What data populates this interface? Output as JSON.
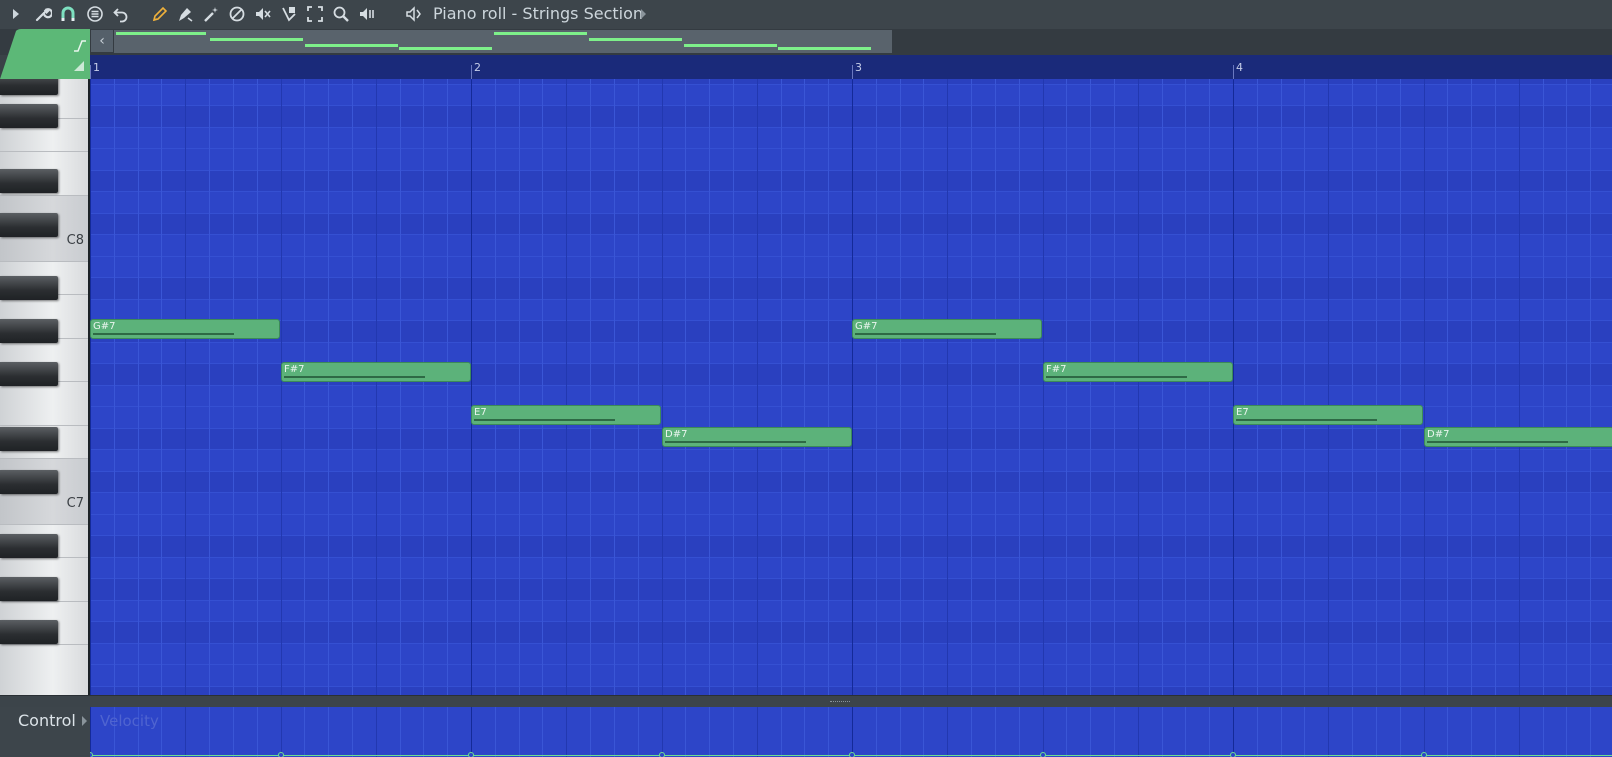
{
  "window": {
    "title": "Piano roll - Strings Section"
  },
  "toolbar": {
    "tools": [
      {
        "name": "wrench-icon",
        "active": false
      },
      {
        "name": "magnet-icon",
        "active": true
      },
      {
        "name": "menu-circle-icon",
        "active": false
      },
      {
        "name": "undo-icon",
        "active": false
      },
      {
        "name": "pencil-icon",
        "active": true
      },
      {
        "name": "paint-brush-icon",
        "active": false
      },
      {
        "name": "magic-wand-icon",
        "active": false
      },
      {
        "name": "delete-icon",
        "active": false
      },
      {
        "name": "mute-icon",
        "active": false
      },
      {
        "name": "slice-icon",
        "active": false
      },
      {
        "name": "select-icon",
        "active": false
      },
      {
        "name": "zoom-icon",
        "active": false
      },
      {
        "name": "playback-icon",
        "active": false
      },
      {
        "name": "speaker-icon",
        "active": false
      }
    ]
  },
  "ruler": {
    "bars": [
      "1",
      "2",
      "3",
      "4"
    ]
  },
  "keyboard": {
    "labels": [
      "C8",
      "C7"
    ]
  },
  "notes": [
    {
      "label": "G#7",
      "pitch": "G#7",
      "start_bar": 1.0,
      "length_beats": 2
    },
    {
      "label": "F#7",
      "pitch": "F#7",
      "start_bar": 1.5,
      "length_beats": 2
    },
    {
      "label": "E7",
      "pitch": "E7",
      "start_bar": 2.0,
      "length_beats": 2
    },
    {
      "label": "D#7",
      "pitch": "D#7",
      "start_bar": 2.5,
      "length_beats": 2
    },
    {
      "label": "G#7",
      "pitch": "G#7",
      "start_bar": 3.0,
      "length_beats": 2
    },
    {
      "label": "F#7",
      "pitch": "F#7",
      "start_bar": 3.5,
      "length_beats": 2
    },
    {
      "label": "E7",
      "pitch": "E7",
      "start_bar": 4.0,
      "length_beats": 2
    },
    {
      "label": "D#7",
      "pitch": "D#7",
      "start_bar": 4.5,
      "length_beats": 2
    }
  ],
  "control": {
    "label": "Control",
    "target": "Velocity"
  },
  "colors": {
    "grid": "#2d45c8",
    "note": "#5cb27a",
    "accent": "#7ef08a"
  }
}
